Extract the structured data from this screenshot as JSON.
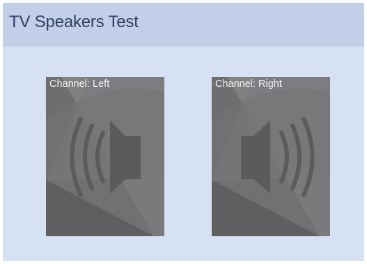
{
  "window": {
    "title": "TV Speakers Test"
  },
  "channels": [
    {
      "prefix": "Channel:",
      "name": "Left",
      "icon": "speaker-left-icon"
    },
    {
      "prefix": "Channel:",
      "name": "Right",
      "icon": "speaker-right-icon"
    }
  ],
  "colors": {
    "background": "#d6e1f3",
    "title_bar": "#c3cfe9",
    "title_text": "#2f3f63",
    "panel": "#6e6e70",
    "panel_light": "#8a8a8d",
    "speaker": "#5b5b5e"
  }
}
